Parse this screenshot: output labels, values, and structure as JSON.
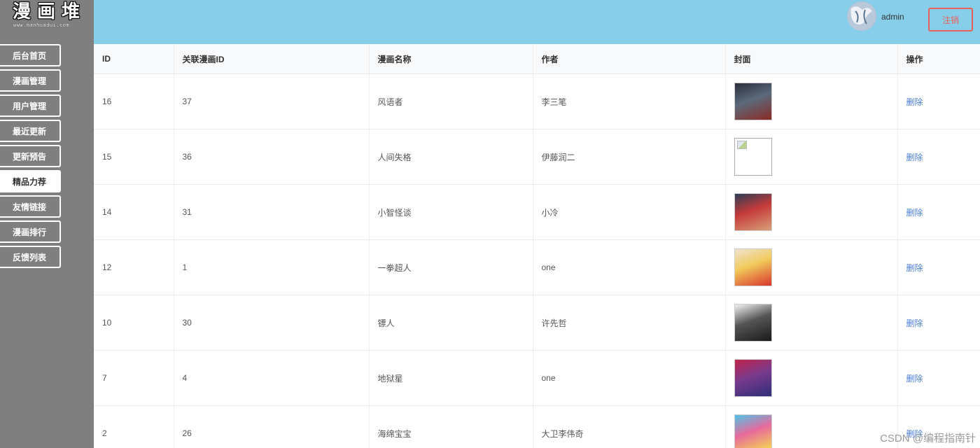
{
  "logo": {
    "title": "漫画堆",
    "subtitle": "www.manhuadui.com"
  },
  "sidebar": {
    "items": [
      {
        "label": "后台首页",
        "active": false
      },
      {
        "label": "漫画管理",
        "active": false
      },
      {
        "label": "用户管理",
        "active": false
      },
      {
        "label": "最近更新",
        "active": false
      },
      {
        "label": "更新预告",
        "active": false
      },
      {
        "label": "精品力荐",
        "active": true
      },
      {
        "label": "友情链接",
        "active": false
      },
      {
        "label": "漫画排行",
        "active": false
      },
      {
        "label": "反馈列表",
        "active": false
      }
    ]
  },
  "header": {
    "username": "admin",
    "logout_label": "注销"
  },
  "table": {
    "columns": [
      "ID",
      "关联漫画ID",
      "漫画名称",
      "作者",
      "封面",
      "操作"
    ],
    "rows": [
      {
        "id": "16",
        "comic_id": "37",
        "name": "风语者",
        "author": "李三笔",
        "cover": [
          "#2a2d3a",
          "#8a2b25",
          "#5b6a7c"
        ],
        "action": "删除"
      },
      {
        "id": "15",
        "comic_id": "36",
        "name": "人间失格",
        "author": "伊藤润二",
        "cover": "broken",
        "action": "删除"
      },
      {
        "id": "14",
        "comic_id": "31",
        "name": "小智怪谈",
        "author": "小冷",
        "cover": [
          "#2c3e55",
          "#d9a07a",
          "#c53a3a"
        ],
        "action": "删除"
      },
      {
        "id": "12",
        "comic_id": "1",
        "name": "一拳超人",
        "author": "one",
        "cover": [
          "#f0e4d0",
          "#d8342c",
          "#f1c95a"
        ],
        "action": "删除"
      },
      {
        "id": "10",
        "comic_id": "30",
        "name": "镖人",
        "author": "许先哲",
        "cover": [
          "#f4f4f4",
          "#1a1a1a",
          "#555555"
        ],
        "action": "删除"
      },
      {
        "id": "7",
        "comic_id": "4",
        "name": "地狱星",
        "author": "one",
        "cover": [
          "#c0234b",
          "#2e2f7a",
          "#7a3a8c"
        ],
        "action": "删除"
      },
      {
        "id": "2",
        "comic_id": "26",
        "name": "海绵宝宝",
        "author": "大卫李伟奇",
        "cover": [
          "#4fc3e8",
          "#f6e04a",
          "#e86a9c"
        ],
        "action": "删除"
      }
    ]
  },
  "watermark": "CSDN @编程指南针",
  "colors": {
    "header_bg": "#87ceeb",
    "sidebar_bg": "#7f7f7f",
    "logout": "#e8605a",
    "link": "#4a7fd4"
  }
}
